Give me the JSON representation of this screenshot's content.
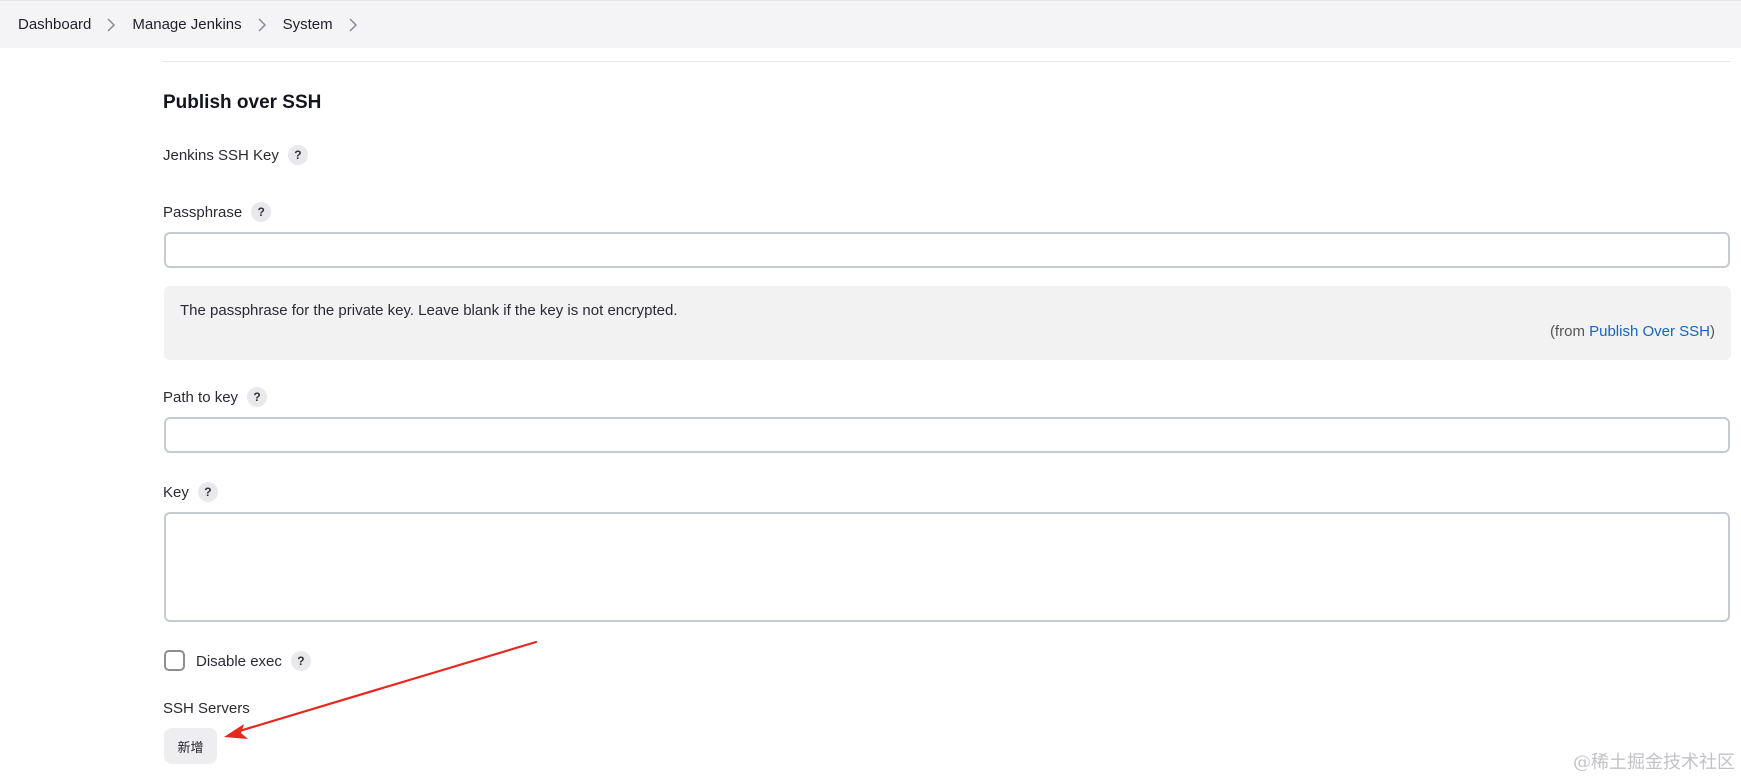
{
  "breadcrumb": {
    "items": [
      "Dashboard",
      "Manage Jenkins",
      "System"
    ]
  },
  "section": {
    "title": "Publish over SSH"
  },
  "fields": {
    "jenkins_ssh_key": {
      "label": "Jenkins SSH Key",
      "help": "?"
    },
    "passphrase": {
      "label": "Passphrase",
      "help": "?",
      "value": ""
    },
    "passphrase_help": {
      "text": "The passphrase for the private key. Leave blank if the key is not encrypted.",
      "from_prefix": "(from ",
      "from_link": "Publish Over SSH",
      "from_suffix": ")"
    },
    "path_to_key": {
      "label": "Path to key",
      "help": "?",
      "value": ""
    },
    "key": {
      "label": "Key",
      "help": "?",
      "value": ""
    },
    "disable_exec": {
      "label": "Disable exec",
      "help": "?",
      "checked": false
    },
    "ssh_servers": {
      "label": "SSH Servers",
      "add_button": "新增"
    }
  },
  "annotation": {
    "arrow_color": "#e8281f"
  },
  "watermark": {
    "text": "@稀土掘金技术社区"
  },
  "colors": {
    "link": "#1565c0",
    "breadcrumb_bg": "#f4f4f6"
  }
}
